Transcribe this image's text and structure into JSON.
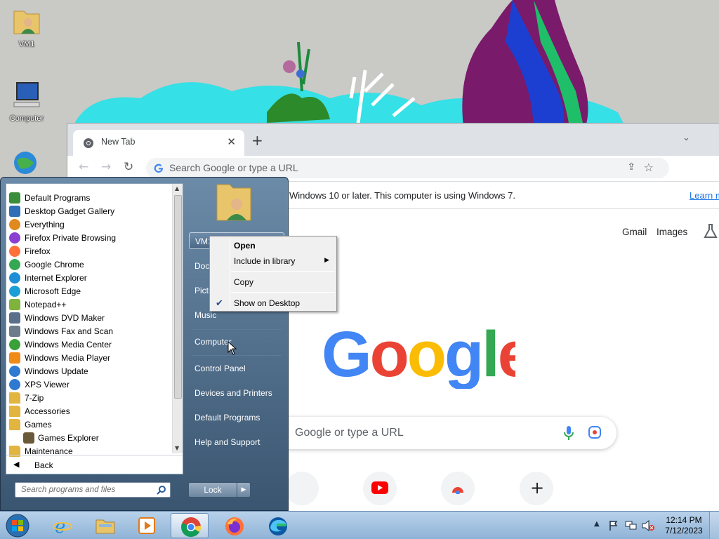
{
  "desktop": {
    "icons": [
      {
        "label": "VM1",
        "icon": "user-folder-icon"
      },
      {
        "label": "Computer",
        "icon": "computer-icon"
      },
      {
        "label": "",
        "icon": "network-globe-icon"
      }
    ]
  },
  "browser": {
    "tab_title": "New Tab",
    "omnibox_placeholder": "Search Google or type a URL",
    "infobar_message": "Windows 10 or later. This computer is using Windows 7.",
    "infobar_link": "Learn m",
    "links": {
      "gmail": "Gmail",
      "images": "Images"
    },
    "search_placeholder": "Google or type a URL"
  },
  "start_menu": {
    "programs": [
      {
        "label": "Default Programs",
        "icon": "default-programs-icon",
        "color": "#3a8d3a"
      },
      {
        "label": "Desktop Gadget Gallery",
        "icon": "gadget-gallery-icon",
        "color": "#2f6fb5"
      },
      {
        "label": "Everything",
        "icon": "magnifier-icon",
        "color": "#e08a1e"
      },
      {
        "label": "Firefox Private Browsing",
        "icon": "firefox-private-icon",
        "color": "#8a3fd1"
      },
      {
        "label": "Firefox",
        "icon": "firefox-icon",
        "color": "#ff7139"
      },
      {
        "label": "Google Chrome",
        "icon": "chrome-icon",
        "color": "#34a853"
      },
      {
        "label": "Internet Explorer",
        "icon": "ie-icon",
        "color": "#1e8fd6"
      },
      {
        "label": "Microsoft Edge",
        "icon": "edge-icon",
        "color": "#1c9fd6"
      },
      {
        "label": "Notepad++",
        "icon": "notepadpp-icon",
        "color": "#7fb33c"
      },
      {
        "label": "Windows DVD Maker",
        "icon": "dvd-maker-icon",
        "color": "#5a6f8a"
      },
      {
        "label": "Windows Fax and Scan",
        "icon": "fax-scan-icon",
        "color": "#6e7b8b"
      },
      {
        "label": "Windows Media Center",
        "icon": "media-center-icon",
        "color": "#3aa03a"
      },
      {
        "label": "Windows Media Player",
        "icon": "media-player-icon",
        "color": "#f08a18"
      },
      {
        "label": "Windows Update",
        "icon": "windows-update-icon",
        "color": "#2e7bd1"
      },
      {
        "label": "XPS Viewer",
        "icon": "xps-viewer-icon",
        "color": "#2f7ad0"
      },
      {
        "label": "7-Zip",
        "icon": "folder-icon",
        "color": "#e2b440"
      },
      {
        "label": "Accessories",
        "icon": "folder-icon",
        "color": "#e2b440"
      },
      {
        "label": "Games",
        "icon": "folder-icon",
        "color": "#e2b440"
      },
      {
        "label": "Games Explorer",
        "icon": "games-explorer-icon",
        "color": "#6b5a3a",
        "indent": true
      },
      {
        "label": "Maintenance",
        "icon": "folder-icon",
        "color": "#e2b440"
      }
    ],
    "back_label": "Back",
    "search_placeholder": "Search programs and files",
    "right_links": [
      "VM1",
      "Doc",
      "Pictu",
      "Music",
      "Computer",
      "Control Panel",
      "Devices and Printers",
      "Default Programs",
      "Help and Support"
    ],
    "lock_label": "Lock"
  },
  "context_menu": {
    "items": [
      {
        "label": "Open",
        "bold": true
      },
      {
        "label": "Include in library",
        "submenu": true
      },
      {
        "label": "Copy"
      },
      {
        "label": "Show on Desktop",
        "checked": true
      }
    ]
  },
  "taskbar": {
    "apps": [
      "ie-icon",
      "explorer-icon",
      "media-player-icon",
      "chrome-icon",
      "firefox-icon",
      "edge-icon"
    ],
    "active_app": "chrome-icon",
    "time": "12:14 PM",
    "date": "7/12/2023"
  },
  "colors": {
    "taskbar": "#a6c4e2",
    "start_menu": "#4f6d8c",
    "link": "#1a73e8"
  }
}
